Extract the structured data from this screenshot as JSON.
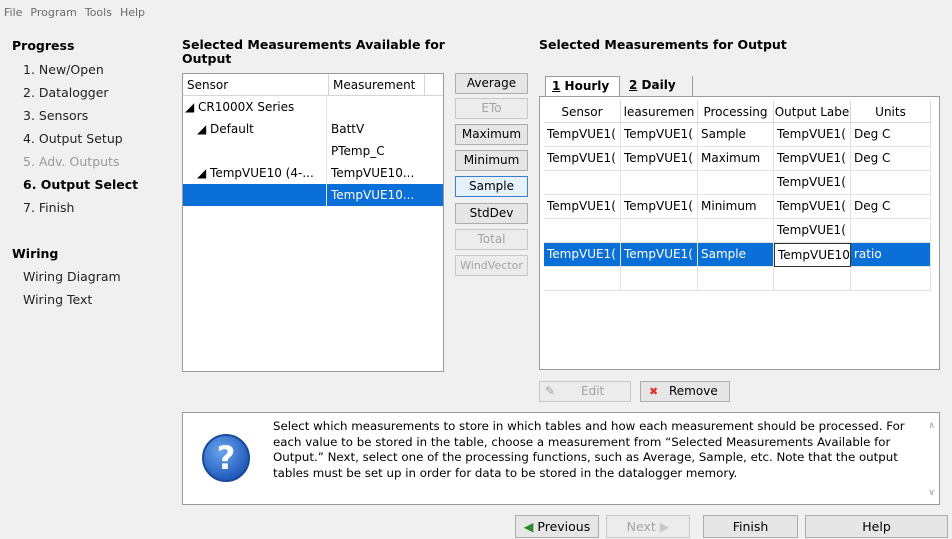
{
  "menu": [
    "File",
    "Program",
    "Tools",
    "Help"
  ],
  "progress": {
    "title": "Progress",
    "items": [
      {
        "label": "1. New/Open",
        "state": "normal"
      },
      {
        "label": "2. Datalogger",
        "state": "normal"
      },
      {
        "label": "3. Sensors",
        "state": "normal"
      },
      {
        "label": "4. Output Setup",
        "state": "normal"
      },
      {
        "label": "5. Adv. Outputs",
        "state": "disabled"
      },
      {
        "label": "6. Output Select",
        "state": "current"
      },
      {
        "label": "7. Finish",
        "state": "normal"
      }
    ]
  },
  "wiring": {
    "title": "Wiring",
    "items": [
      "Wiring Diagram",
      "Wiring Text"
    ]
  },
  "available": {
    "heading": "Selected Measurements Available for Output",
    "columns": [
      "Sensor",
      "Measurement"
    ],
    "rows": [
      {
        "sensor": "◢ CR1000X Series",
        "measurement": ""
      },
      {
        "sensor": "◢ Default",
        "measurement": "BattV"
      },
      {
        "sensor": "",
        "measurement": "PTemp_C"
      },
      {
        "sensor": "◢ TempVUE10 (4-...",
        "measurement": "TempVUE10..."
      },
      {
        "sensor": "",
        "measurement": "TempVUE10..."
      }
    ]
  },
  "processing_buttons": [
    {
      "label": "Average",
      "enabled": true
    },
    {
      "label": "ETo",
      "enabled": false
    },
    {
      "label": "Maximum",
      "enabled": true
    },
    {
      "label": "Minimum",
      "enabled": true
    },
    {
      "label": "Sample",
      "enabled": true
    },
    {
      "label": "StdDev",
      "enabled": true
    },
    {
      "label": "Total",
      "enabled": false
    },
    {
      "label": "WindVector",
      "enabled": false
    }
  ],
  "output": {
    "heading": "Selected Measurements for Output",
    "tabs": [
      {
        "num": "1",
        "label": "Hourly"
      },
      {
        "num": "2",
        "label": "Daily"
      }
    ],
    "columns": [
      "Sensor",
      "leasuremen",
      "Processing",
      "Output Labe",
      "Units"
    ],
    "rows": [
      [
        "TempVUE1(",
        "TempVUE1(",
        "Sample",
        "TempVUE1(",
        "Deg C"
      ],
      [
        "TempVUE1(",
        "TempVUE1(",
        "Maximum",
        "TempVUE1(",
        "Deg C"
      ],
      [
        "",
        "",
        "",
        "TempVUE1(",
        ""
      ],
      [
        "TempVUE1(",
        "TempVUE1(",
        "Minimum",
        "TempVUE1(",
        "Deg C"
      ],
      [
        "",
        "",
        "",
        "TempVUE1(",
        ""
      ],
      [
        "TempVUE1(",
        "TempVUE1(",
        "Sample",
        "TempVUE10",
        "ratio"
      ]
    ],
    "edit_label": "Edit",
    "remove_label": "Remove"
  },
  "help_text": "Select which measurements to store in which tables and how each measurement should be processed. For each value to be stored in the table, choose a measurement from “Selected Measurements Available for Output.” Next, select one of the processing functions, such as Average, Sample, etc. Note that the output tables must be set up in order for data to be stored in the datalogger memory.",
  "nav": {
    "previous": "Previous",
    "next": "Next",
    "finish": "Finish",
    "help": "Help"
  }
}
